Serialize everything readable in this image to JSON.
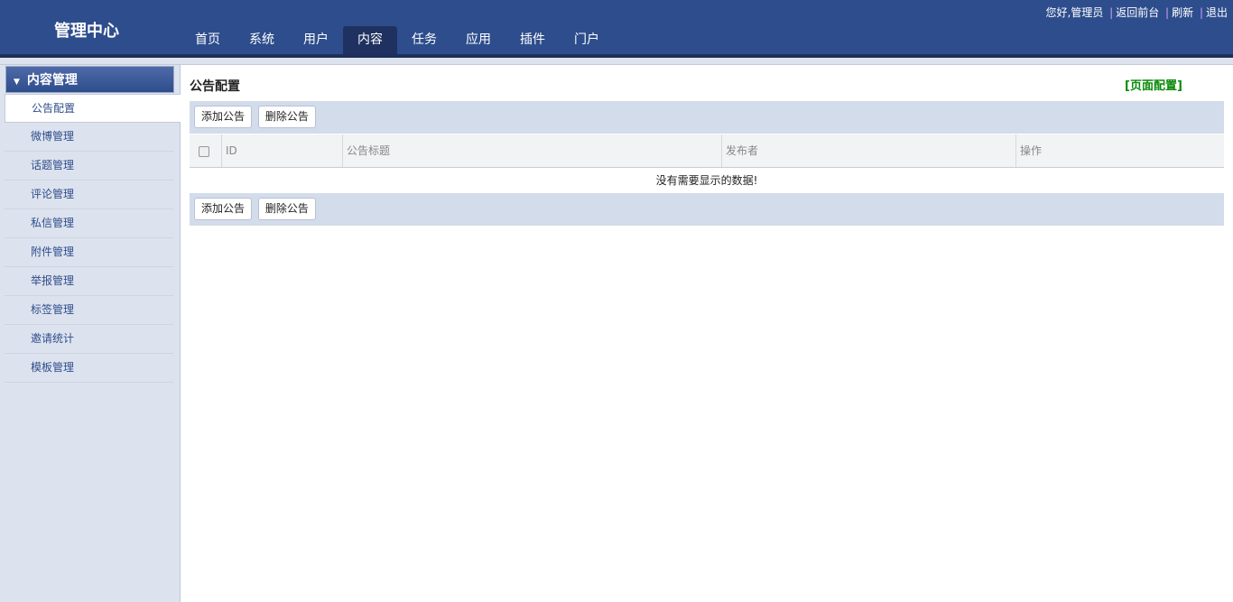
{
  "header": {
    "logo": "管理中心",
    "nav": [
      "首页",
      "系统",
      "用户",
      "内容",
      "任务",
      "应用",
      "插件",
      "门户"
    ],
    "active_nav": "内容",
    "greeting": "您好,管理员",
    "links": [
      "返回前台",
      "刷新",
      "退出"
    ]
  },
  "sidebar": {
    "title": "内容管理",
    "items": [
      "公告配置",
      "微博管理",
      "话题管理",
      "评论管理",
      "私信管理",
      "附件管理",
      "举报管理",
      "标签管理",
      "邀请统计",
      "模板管理"
    ]
  },
  "main": {
    "title": "公告配置",
    "page_config": "[页面配置]",
    "add_label": "添加公告",
    "delete_label": "删除公告",
    "columns": [
      "ID",
      "公告标题",
      "发布者",
      "操作"
    ],
    "empty_text": "没有需要显示的数据!"
  }
}
